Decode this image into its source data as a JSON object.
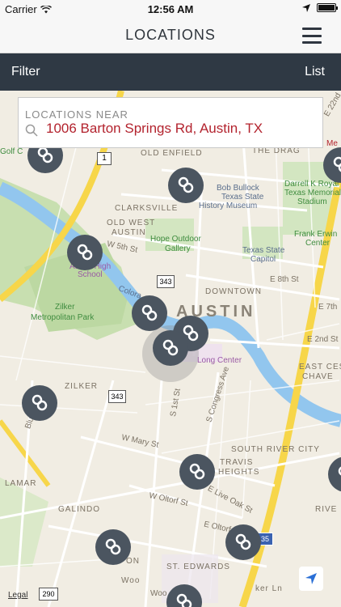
{
  "status": {
    "carrier": "Carrier",
    "time": "12:56 AM"
  },
  "nav": {
    "title": "LOCATIONS",
    "menu_icon": "hamburger-icon"
  },
  "toolbar": {
    "filter_label": "Filter",
    "list_label": "List"
  },
  "search": {
    "caption": "LOCATIONS NEAR",
    "value": "1006 Barton Springs Rd, Austin, TX",
    "icon": "search-icon"
  },
  "map": {
    "labels": {
      "old_enfield": "OLD ENFIELD",
      "the_drag": "THE DRAG",
      "clarksville": "CLARKSVILLE",
      "old_west_austin": "OLD WEST",
      "old_west_austin2": "AUSTIN",
      "downtown": "DOWNTOWN",
      "austin": "AUSTIN",
      "zilker": "ZILKER",
      "zilker_park": "Zilker",
      "zilker_park2": "Metropolitan Park",
      "hope_gallery": "Hope Outdoor",
      "hope_gallery2": "Gallery",
      "bullock": "Bob Bullock",
      "bullock2": "Texas State",
      "bullock3": "History Museum",
      "capitol": "Texas State",
      "capitol2": "Capitol",
      "stadium": "Darrell K Royal",
      "stadium2": "Texas Memorial",
      "stadium3": "Stadium",
      "frank_erwin": "Frank Erwin",
      "frank_erwin2": "Center",
      "east_cesar": "EAST CES",
      "east_cesar2": "CHAVE",
      "south_river": "SOUTH RIVER CITY",
      "travis_heights": "TRAVIS",
      "travis_heights2": "HEIGHTS",
      "lamar": "LAMAR",
      "galindo": "GALINDO",
      "st_edwards": "ST. EDWARDS",
      "w5th": "W 5th St",
      "e8th": "E 8th St",
      "e7th": "E 7th",
      "e2nd": "E 2nd St",
      "w_mary": "W Mary St",
      "w_oltorf": "W Oltorf St",
      "e_oltorf": "E Oltorf",
      "e_live_oak": "E Live Oak St",
      "s_congress": "S Congress Ave",
      "s_1st": "S 1st St",
      "colorado": "Colora",
      "long_center": "Long Center",
      "austin_high": "Austin High",
      "austin_high2": "School",
      "river": "RIVE",
      "golf": "Golf C",
      "e22nd": "E 22nd",
      "me": "Me",
      "hwy1": "1",
      "hwy343a": "343",
      "hwy343b": "343",
      "hwy290": "290",
      "hwy35": "35",
      "bluebonnet": "Blueb",
      "woodward": "Woo",
      "ln": "ker Ln",
      "on": "ON"
    }
  },
  "legal_label": "Legal",
  "colors": {
    "accent": "#b3232e",
    "pin": "#4b5560",
    "bar": "#2f3944"
  }
}
